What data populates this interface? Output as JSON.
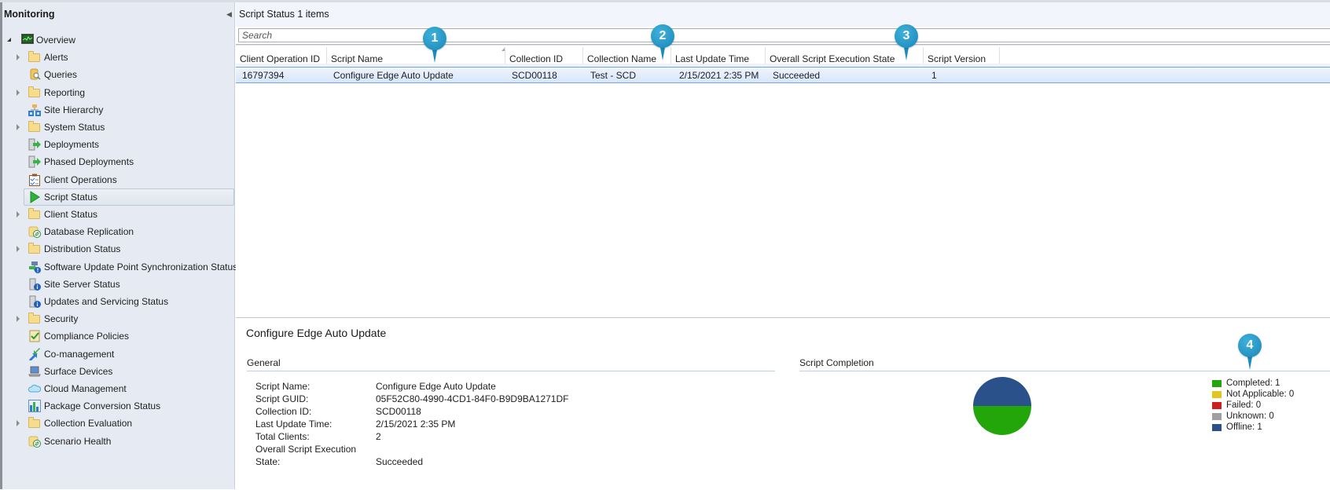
{
  "sidebar": {
    "title": "Monitoring",
    "collapse_icon": "chevron-left-icon",
    "items": [
      {
        "label": "Overview",
        "icon": "overview-monitor-icon",
        "expander": "expanded",
        "level": 0
      },
      {
        "label": "Alerts",
        "icon": "folder-icon",
        "expander": "collapsed",
        "level": 1
      },
      {
        "label": "Queries",
        "icon": "queries-icon",
        "expander": "none",
        "level": 1
      },
      {
        "label": "Reporting",
        "icon": "folder-icon",
        "expander": "collapsed",
        "level": 1
      },
      {
        "label": "Site Hierarchy",
        "icon": "site-hierarchy-icon",
        "expander": "none",
        "level": 1
      },
      {
        "label": "System Status",
        "icon": "folder-icon",
        "expander": "collapsed",
        "level": 1
      },
      {
        "label": "Deployments",
        "icon": "deployments-icon",
        "expander": "none",
        "level": 1
      },
      {
        "label": "Phased Deployments",
        "icon": "phased-deployments-icon",
        "expander": "none",
        "level": 1
      },
      {
        "label": "Client Operations",
        "icon": "client-operations-icon",
        "expander": "none",
        "level": 1
      },
      {
        "label": "Script Status",
        "icon": "play-icon",
        "expander": "none",
        "level": 1,
        "selected": true
      },
      {
        "label": "Client Status",
        "icon": "folder-icon",
        "expander": "collapsed",
        "level": 1
      },
      {
        "label": "Database Replication",
        "icon": "database-replication-icon",
        "expander": "none",
        "level": 1
      },
      {
        "label": "Distribution Status",
        "icon": "folder-icon",
        "expander": "collapsed",
        "level": 1
      },
      {
        "label": "Software Update Point Synchronization Status",
        "icon": "sup-sync-status-icon",
        "expander": "none",
        "level": 1
      },
      {
        "label": "Site Server Status",
        "icon": "server-info-icon",
        "expander": "none",
        "level": 1
      },
      {
        "label": "Updates and Servicing Status",
        "icon": "server-info-icon",
        "expander": "none",
        "level": 1
      },
      {
        "label": "Security",
        "icon": "folder-icon",
        "expander": "collapsed",
        "level": 1
      },
      {
        "label": "Compliance Policies",
        "icon": "compliance-check-icon",
        "expander": "none",
        "level": 1
      },
      {
        "label": "Co-management",
        "icon": "co-management-icon",
        "expander": "none",
        "level": 1
      },
      {
        "label": "Surface Devices",
        "icon": "laptop-icon",
        "expander": "none",
        "level": 1
      },
      {
        "label": "Cloud Management",
        "icon": "cloud-icon",
        "expander": "none",
        "level": 1
      },
      {
        "label": "Package Conversion Status",
        "icon": "bar-chart-icon",
        "expander": "none",
        "level": 1
      },
      {
        "label": "Collection Evaluation",
        "icon": "folder-icon",
        "expander": "collapsed",
        "level": 1
      },
      {
        "label": "Scenario Health",
        "icon": "scenario-health-icon",
        "expander": "none",
        "level": 1
      }
    ]
  },
  "header": {
    "title": "Script Status 1 items"
  },
  "search": {
    "placeholder": "Search",
    "value": ""
  },
  "table": {
    "sorted_column": "Script Name",
    "columns": [
      "Client Operation ID",
      "Script Name",
      "Collection ID",
      "Collection Name",
      "Last Update Time",
      "Overall Script Execution State",
      "Script Version"
    ],
    "rows": [
      [
        "16797394",
        "Configure Edge Auto Update",
        "SCD00118",
        "Test - SCD",
        "2/15/2021 2:35 PM",
        "Succeeded",
        "1"
      ]
    ]
  },
  "details": {
    "title": "Configure Edge Auto Update",
    "general": {
      "heading": "General",
      "fields": [
        {
          "label": "Script Name:",
          "value": "Configure Edge Auto Update"
        },
        {
          "label": "Script GUID:",
          "value": "05F52C80-4990-4CD1-84F0-B9D9BA1271DF"
        },
        {
          "label": "Collection ID:",
          "value": "SCD00118"
        },
        {
          "label": "Last Update Time:",
          "value": "2/15/2021 2:35 PM"
        },
        {
          "label": "Total Clients:",
          "value": "2"
        },
        {
          "label": "Overall Script Execution",
          "value": ""
        },
        {
          "label": "State:",
          "value": "Succeeded"
        }
      ]
    },
    "completion": {
      "heading": "Script Completion"
    }
  },
  "chart_data": {
    "type": "pie",
    "title": "Script Completion",
    "legend_position": "right",
    "categories": [
      "Completed",
      "Not Applicable",
      "Failed",
      "Unknown",
      "Offline"
    ],
    "values": [
      1,
      0,
      0,
      0,
      1
    ],
    "colors": [
      "#22a60a",
      "#e2c422",
      "#cc1f1f",
      "#a0a0a0",
      "#2a5189"
    ],
    "legend_labels": [
      "Completed: 1",
      "Not Applicable: 0",
      "Failed: 0",
      "Unknown: 0",
      "Offline: 1"
    ]
  },
  "callouts": [
    "1",
    "2",
    "3",
    "4"
  ]
}
